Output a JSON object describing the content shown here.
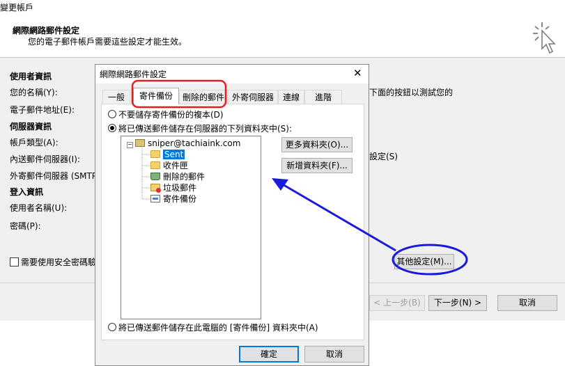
{
  "window": {
    "title": "變更帳戶"
  },
  "header": {
    "title": "網際網路郵件設定",
    "subtitle": "您的電子郵件帳戶需要這些設定才能生效。"
  },
  "form": {
    "user_section": "使用者資訊",
    "your_name": "您的名稱(Y):",
    "email": "電子郵件地址(E):",
    "server_section": "伺服器資訊",
    "account_type": "帳戶類型(A):",
    "incoming": "內送郵件伺服器(I):",
    "outgoing": "外寄郵件伺服器 (SMTP):",
    "login_section": "登入資訊",
    "username": "使用者名稱(U):",
    "password": "密碼(P):",
    "spa_label": "需要使用安全密碼驗",
    "test_text": "下面的按鈕以測試您的",
    "setting_text": "設定(S)",
    "more_settings": "其他設定(M)..."
  },
  "wizard_buttons": {
    "back": "< 上一步(B)",
    "next": "下一步(N) >",
    "cancel": "取消"
  },
  "dialog": {
    "title": "網際網路郵件設定",
    "close": "✕",
    "tabs": [
      "一般",
      "寄件備份",
      "刪除的郵件",
      "外寄伺服器",
      "連線",
      "進階"
    ],
    "active_tab": "寄件備份",
    "option1": "不要儲存寄件備份的複本(D)",
    "option2": "將已傳送郵件儲存在伺服器的下列資料夾中(S):",
    "option3": "將已傳送郵件儲存在此電腦的 [寄件備份] 資料夾中(A)",
    "selected_option": "option2",
    "more_folders": "更多資料夾(O)...",
    "new_folder": "新增資料夾(F)...",
    "tree": {
      "root": "sniper@tachiaink.com",
      "children": [
        "Sent",
        "收件匣",
        "刪除的郵件",
        "垃圾郵件",
        "寄件備份"
      ],
      "selected": "Sent"
    },
    "ok": "確定",
    "cancel": "取消"
  },
  "annotation_colors": {
    "highlight_red": "#e02020",
    "arrow_blue": "#1a1adc"
  }
}
